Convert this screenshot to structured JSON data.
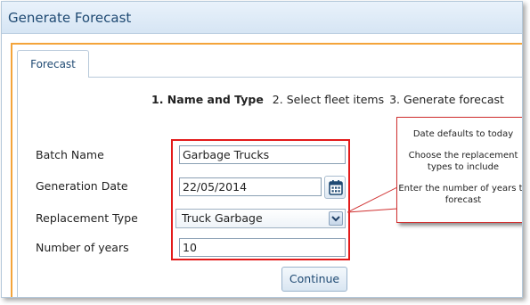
{
  "window": {
    "title": "Generate Forecast"
  },
  "tab": {
    "label": "Forecast"
  },
  "steps": {
    "current": "1. Name and Type",
    "step2": "2. Select fleet items",
    "step3": "3. Generate forecast"
  },
  "form": {
    "batch_name_label": "Batch Name",
    "batch_name_value": "Garbage Trucks",
    "generation_date_label": "Generation Date",
    "generation_date_value": "22/05/2014",
    "replacement_type_label": "Replacement Type",
    "replacement_type_value": "Truck Garbage",
    "years_label": "Number of years",
    "years_value": "10"
  },
  "buttons": {
    "continue": "Continue"
  },
  "callout": {
    "line1": "Date defaults to today",
    "line2": "Choose the replacement types to include",
    "line3": "Enter the number of years to forecast"
  },
  "colors": {
    "accent_orange": "#f4a43a",
    "highlight_red": "#e31b1b",
    "title_blue": "#1f4a73"
  },
  "icons": {
    "date_picker": "calendar-icon",
    "dropdown": "chevron-down-icon"
  }
}
